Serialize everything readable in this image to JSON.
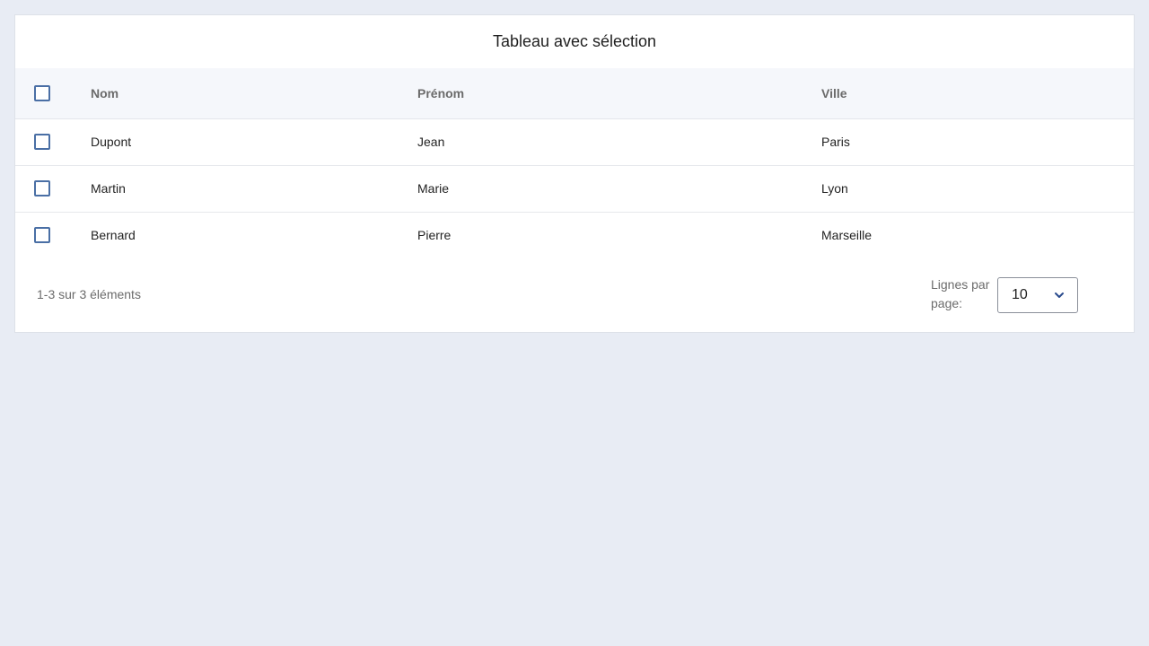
{
  "table": {
    "title": "Tableau avec sélection",
    "columns": [
      "Nom",
      "Prénom",
      "Ville"
    ],
    "rows": [
      {
        "nom": "Dupont",
        "prenom": "Jean",
        "ville": "Paris"
      },
      {
        "nom": "Martin",
        "prenom": "Marie",
        "ville": "Lyon"
      },
      {
        "nom": "Bernard",
        "prenom": "Pierre",
        "ville": "Marseille"
      }
    ]
  },
  "footer": {
    "count": "1-3 sur 3 éléments",
    "rows_per_page_label": "Lignes par page:",
    "rows_per_page_value": "10",
    "select_icon": "chevron-down-icon"
  },
  "colors": {
    "background": "#e8ecf4",
    "header_background": "#f5f7fb",
    "checkbox_border": "#4a6fa5",
    "chevron": "#2a4b8d"
  }
}
